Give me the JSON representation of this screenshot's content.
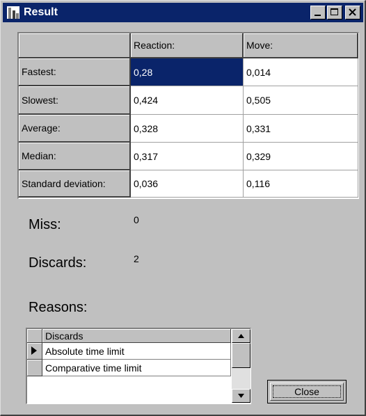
{
  "window": {
    "title": "Result"
  },
  "results": {
    "columns": [
      "Reaction:",
      "Move:"
    ],
    "rows": [
      {
        "label": "Fastest:",
        "reaction": "0,28",
        "move": "0,014"
      },
      {
        "label": "Slowest:",
        "reaction": "0,424",
        "move": "0,505"
      },
      {
        "label": "Average:",
        "reaction": "0,328",
        "move": "0,331"
      },
      {
        "label": "Median:",
        "reaction": "0,317",
        "move": "0,329"
      },
      {
        "label": "Standard deviation:",
        "reaction": "0,036",
        "move": "0,116"
      }
    ]
  },
  "miss": {
    "label": "Miss:",
    "value": "0"
  },
  "discards": {
    "label": "Discards:",
    "value": "2"
  },
  "reasons": {
    "label": "Reasons:",
    "header": "Discards",
    "items": [
      "Absolute time limit",
      "Comparative time limit"
    ]
  },
  "buttons": {
    "close": "Close"
  }
}
